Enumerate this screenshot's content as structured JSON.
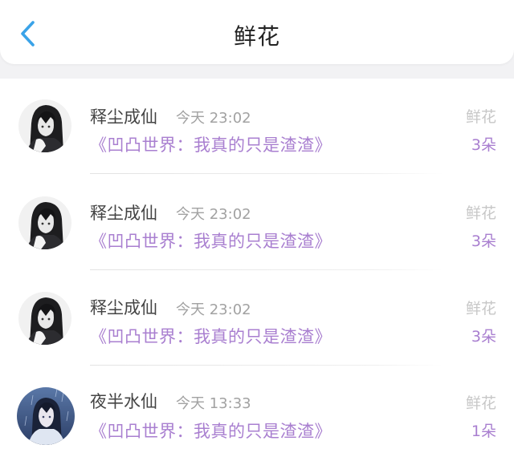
{
  "header": {
    "back_icon": "chevron-left-icon",
    "title": "鲜花",
    "accent_color": "#3aa3e8"
  },
  "records": [
    {
      "avatar": "dark-hair-girl-avatar",
      "name": "释尘成仙",
      "time": "今天 23:02",
      "book": "《凹凸世界：我真的只是渣渣》",
      "gift_type": "鲜花",
      "count": "3朵"
    },
    {
      "avatar": "dark-hair-girl-avatar",
      "name": "释尘成仙",
      "time": "今天 23:02",
      "book": "《凹凸世界：我真的只是渣渣》",
      "gift_type": "鲜花",
      "count": "3朵"
    },
    {
      "avatar": "dark-hair-girl-avatar",
      "name": "释尘成仙",
      "time": "今天 23:02",
      "book": "《凹凸世界：我真的只是渣渣》",
      "gift_type": "鲜花",
      "count": "3朵"
    },
    {
      "avatar": "blue-rain-girl-avatar",
      "name": "夜半水仙",
      "time": "今天 13:33",
      "book": "《凹凸世界：我真的只是渣渣》",
      "gift_type": "鲜花",
      "count": "1朵"
    }
  ],
  "colors": {
    "book_link": "#a97fd0",
    "muted_text": "#a2a2a2",
    "gift_type_text": "#c7c7c7"
  }
}
